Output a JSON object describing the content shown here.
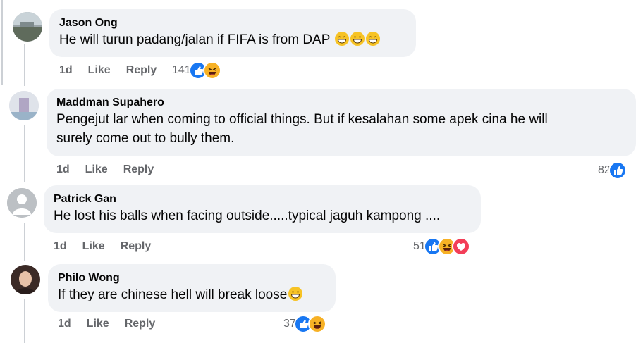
{
  "comments": [
    {
      "author": "Jason Ong",
      "text": "He will turun padang/jalan if FIFA is from DAP",
      "age": "1d",
      "like": "Like",
      "reply": "Reply",
      "reaction_count": "141",
      "reactions": [
        "like-icon",
        "haha-icon"
      ],
      "trailing_emojis": [
        "grin-icon",
        "grin-icon",
        "grin-icon"
      ]
    },
    {
      "author": "Maddman Supahero",
      "text_lines": [
        "Pengejut lar when coming to official things. But if kesalahan some apek cina he will",
        "surely come out to bully them."
      ],
      "age": "1d",
      "like": "Like",
      "reply": "Reply",
      "reaction_count": "82",
      "reactions": [
        "like-icon"
      ]
    },
    {
      "author": "Patrick Gan",
      "text": "He lost his balls when facing outside.....typical jaguh kampong ....",
      "age": "1d",
      "like": "Like",
      "reply": "Reply",
      "reaction_count": "51",
      "reactions": [
        "like-icon",
        "haha-icon",
        "love-icon"
      ]
    },
    {
      "author": "Philo Wong",
      "text": "If they are chinese hell will break loose",
      "age": "1d",
      "like": "Like",
      "reply": "Reply",
      "reaction_count": "37",
      "reactions": [
        "like-icon",
        "haha-icon"
      ],
      "trailing_emojis": [
        "sweat-smile-icon"
      ]
    }
  ],
  "colors": {
    "bubble": "#f0f2f5",
    "secondary_text": "#65676b",
    "like": "#1877f2",
    "haha": "#f7b125",
    "love": "#f33e58"
  }
}
